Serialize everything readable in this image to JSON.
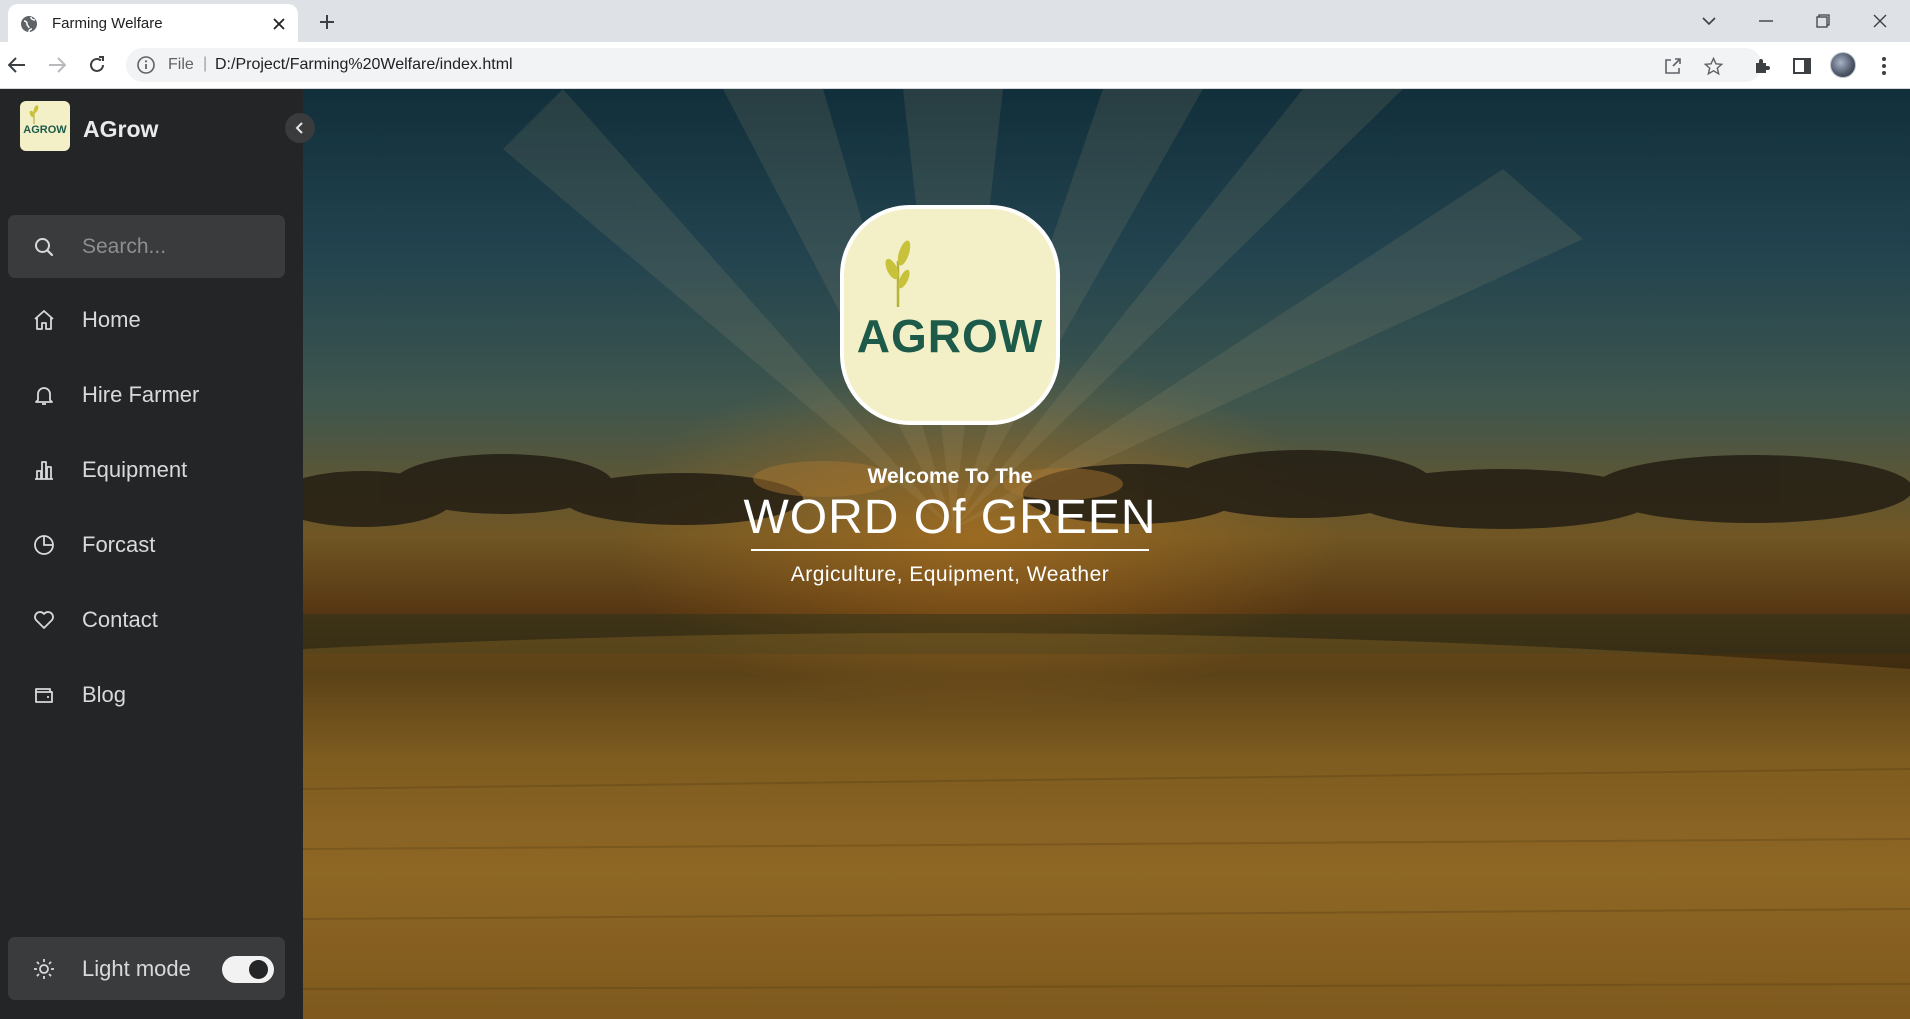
{
  "browser": {
    "tab_title": "Farming Welfare",
    "url_scheme": "File",
    "url_separator": "|",
    "url": "D:/Project/Farming%20Welfare/index.html"
  },
  "sidebar": {
    "brand_logo_text": "AGROW",
    "brand_name": "AGrow",
    "search_placeholder": "Search...",
    "items": [
      {
        "label": "Home",
        "icon": "home-icon"
      },
      {
        "label": "Hire Farmer",
        "icon": "bell-icon"
      },
      {
        "label": "Equipment",
        "icon": "bar-chart-icon"
      },
      {
        "label": "Forcast",
        "icon": "pie-chart-icon"
      },
      {
        "label": "Contact",
        "icon": "heart-icon"
      },
      {
        "label": "Blog",
        "icon": "wallet-icon"
      }
    ],
    "mode_label": "Light mode"
  },
  "hero": {
    "logo_text": "AGROW",
    "welcome": "Welcome To The",
    "title": "WORD Of GREEN",
    "tagline": "Argiculture, Equipment, Weather"
  },
  "colors": {
    "sidebar_bg": "#242526",
    "logo_bg": "#f3f0c8",
    "logo_green": "#1d5a49",
    "wheat_accent": "#c8c23a"
  }
}
